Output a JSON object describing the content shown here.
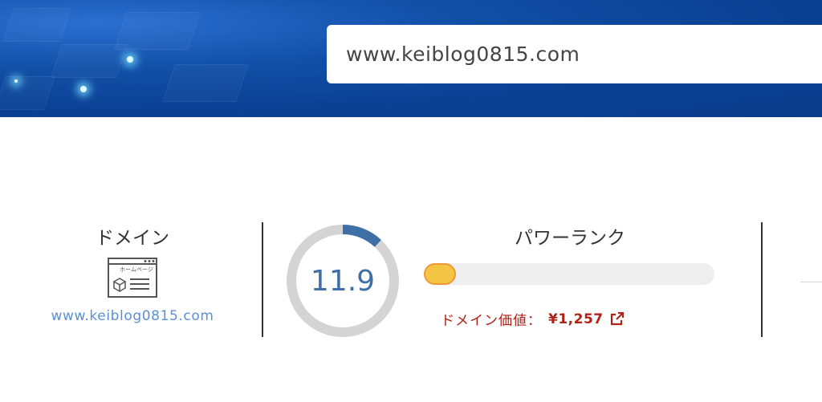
{
  "search": {
    "value": "www.keiblog0815.com"
  },
  "domain": {
    "title": "ドメイン",
    "icon_text": "ホームページ",
    "url": "www.keiblog0815.com"
  },
  "score": {
    "value": "11.9",
    "ring_fraction": 0.12
  },
  "power_rank": {
    "title": "パワーランク",
    "bar_fraction": 0.11,
    "value_label": "ドメイン価値：",
    "value_amount": "¥1,257"
  },
  "colors": {
    "header_blue": "#0b3f8f",
    "link_blue": "#5b8fd6",
    "score_blue": "#3e6fa6",
    "value_red": "#b02218",
    "bar_yellow": "#f6c443"
  }
}
